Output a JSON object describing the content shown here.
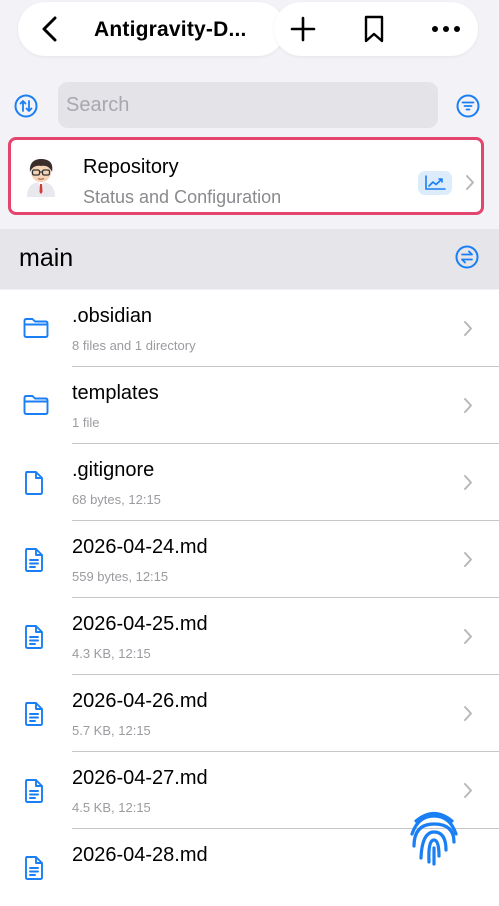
{
  "header": {
    "title": "Antigravity-D...",
    "back_icon": "chevron-left-icon",
    "add_icon": "plus-icon",
    "bookmark_icon": "bookmark-icon",
    "more_icon": "ellipsis-icon"
  },
  "search": {
    "placeholder": "Search"
  },
  "repository": {
    "title": "Repository",
    "subtitle": "Status and Configuration"
  },
  "branch": {
    "name": "main"
  },
  "files": [
    {
      "name": ".obsidian",
      "meta": "8 files and 1 directory",
      "type": "folder"
    },
    {
      "name": "templates",
      "meta": "1 file",
      "type": "folder"
    },
    {
      "name": ".gitignore",
      "meta": "68 bytes, 12:15",
      "type": "file"
    },
    {
      "name": "2026-04-24.md",
      "meta": "559 bytes, 12:15",
      "type": "text"
    },
    {
      "name": "2026-04-25.md",
      "meta": "4.3 KB, 12:15",
      "type": "text"
    },
    {
      "name": "2026-04-26.md",
      "meta": "5.7 KB, 12:15",
      "type": "text"
    },
    {
      "name": "2026-04-27.md",
      "meta": "4.5 KB, 12:15",
      "type": "text"
    },
    {
      "name": "2026-04-28.md",
      "meta": "",
      "type": "text"
    }
  ],
  "colors": {
    "accent": "#1a7ff5",
    "highlight": "#e3456e",
    "secondary_text": "#8a8a8e"
  }
}
